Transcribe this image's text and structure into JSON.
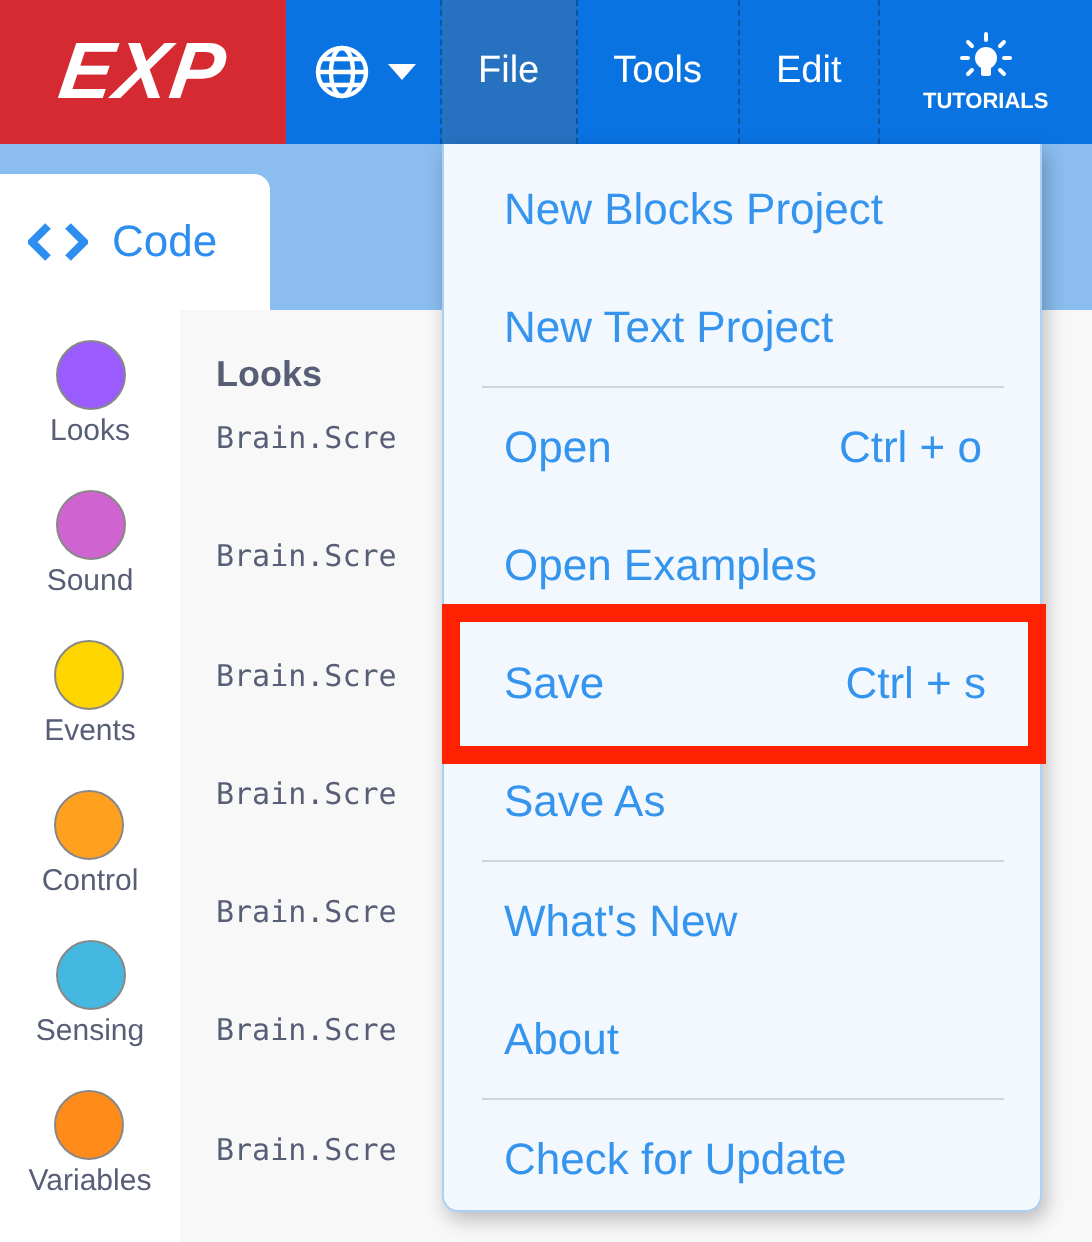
{
  "logo": "EXP",
  "nav": [
    {
      "label": "File",
      "selected": true
    },
    {
      "label": "Tools",
      "selected": false
    },
    {
      "label": "Edit",
      "selected": false
    }
  ],
  "tutorials": "TUTORIALS",
  "code_tab": {
    "label": "Code"
  },
  "categories": [
    {
      "label": "Looks",
      "color": "#9a5cff"
    },
    {
      "label": "Sound",
      "color": "#cf63cf"
    },
    {
      "label": "Events",
      "color": "#ffd500"
    },
    {
      "label": "Control",
      "color": "#ffa01f"
    },
    {
      "label": "Sensing",
      "color": "#44b8e0"
    },
    {
      "label": "Variables",
      "color": "#ff8c1a"
    }
  ],
  "code_panel": {
    "heading": "Looks",
    "lines": [
      "Brain.Scre",
      "Brain.Scre",
      "Brain.Scre",
      "Brain.Scre",
      "Brain.Scre",
      "Brain.Scre",
      "Brain.Scre"
    ]
  },
  "file_menu": [
    [
      {
        "label": "New Blocks Project",
        "highlighted": false
      },
      {
        "label": "New Text Project",
        "highlighted": false
      }
    ],
    [
      {
        "label": "Open",
        "shortcut": "Ctrl + o",
        "highlighted": false
      },
      {
        "label": "Open Examples",
        "highlighted": false
      },
      {
        "label": "Save",
        "shortcut": "Ctrl + s",
        "highlighted": true
      },
      {
        "label": "Save As",
        "highlighted": false
      }
    ],
    [
      {
        "label": "What's New",
        "highlighted": false
      },
      {
        "label": "About",
        "highlighted": false
      }
    ],
    [
      {
        "label": "Check for Update",
        "highlighted": false
      }
    ]
  ]
}
